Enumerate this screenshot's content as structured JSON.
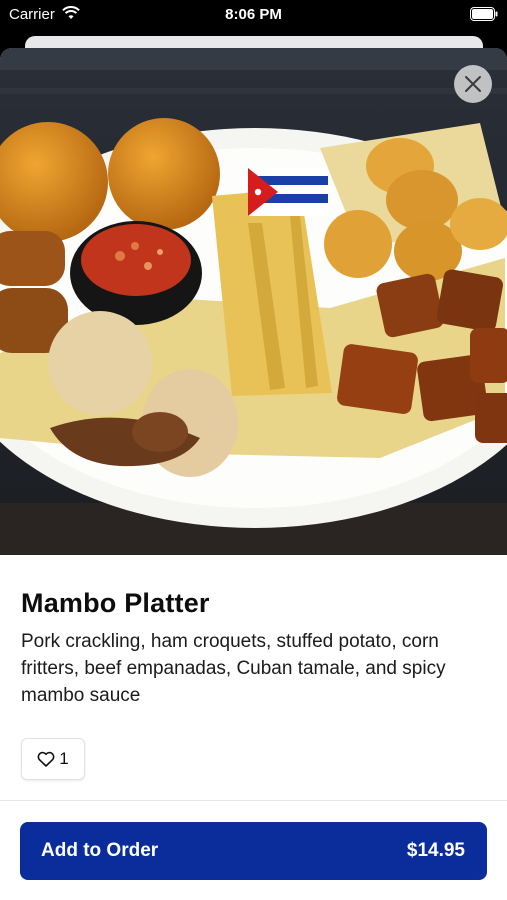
{
  "status_bar": {
    "carrier": "Carrier",
    "time": "8:06 PM"
  },
  "item": {
    "name": "Mambo Platter",
    "description": "Pork crackling, ham croquets, stuffed potato, corn fritters, beef empanadas, Cuban tamale, and spicy mambo sauce",
    "like_count": "1",
    "image_icon": "food-photo"
  },
  "actions": {
    "add_label": "Add to Order",
    "price": "$14.95",
    "close_icon": "close-icon",
    "like_icon": "heart-icon"
  },
  "colors": {
    "primary_button": "#0a2d9b",
    "background": "#ffffff",
    "status_bar": "#000000"
  }
}
